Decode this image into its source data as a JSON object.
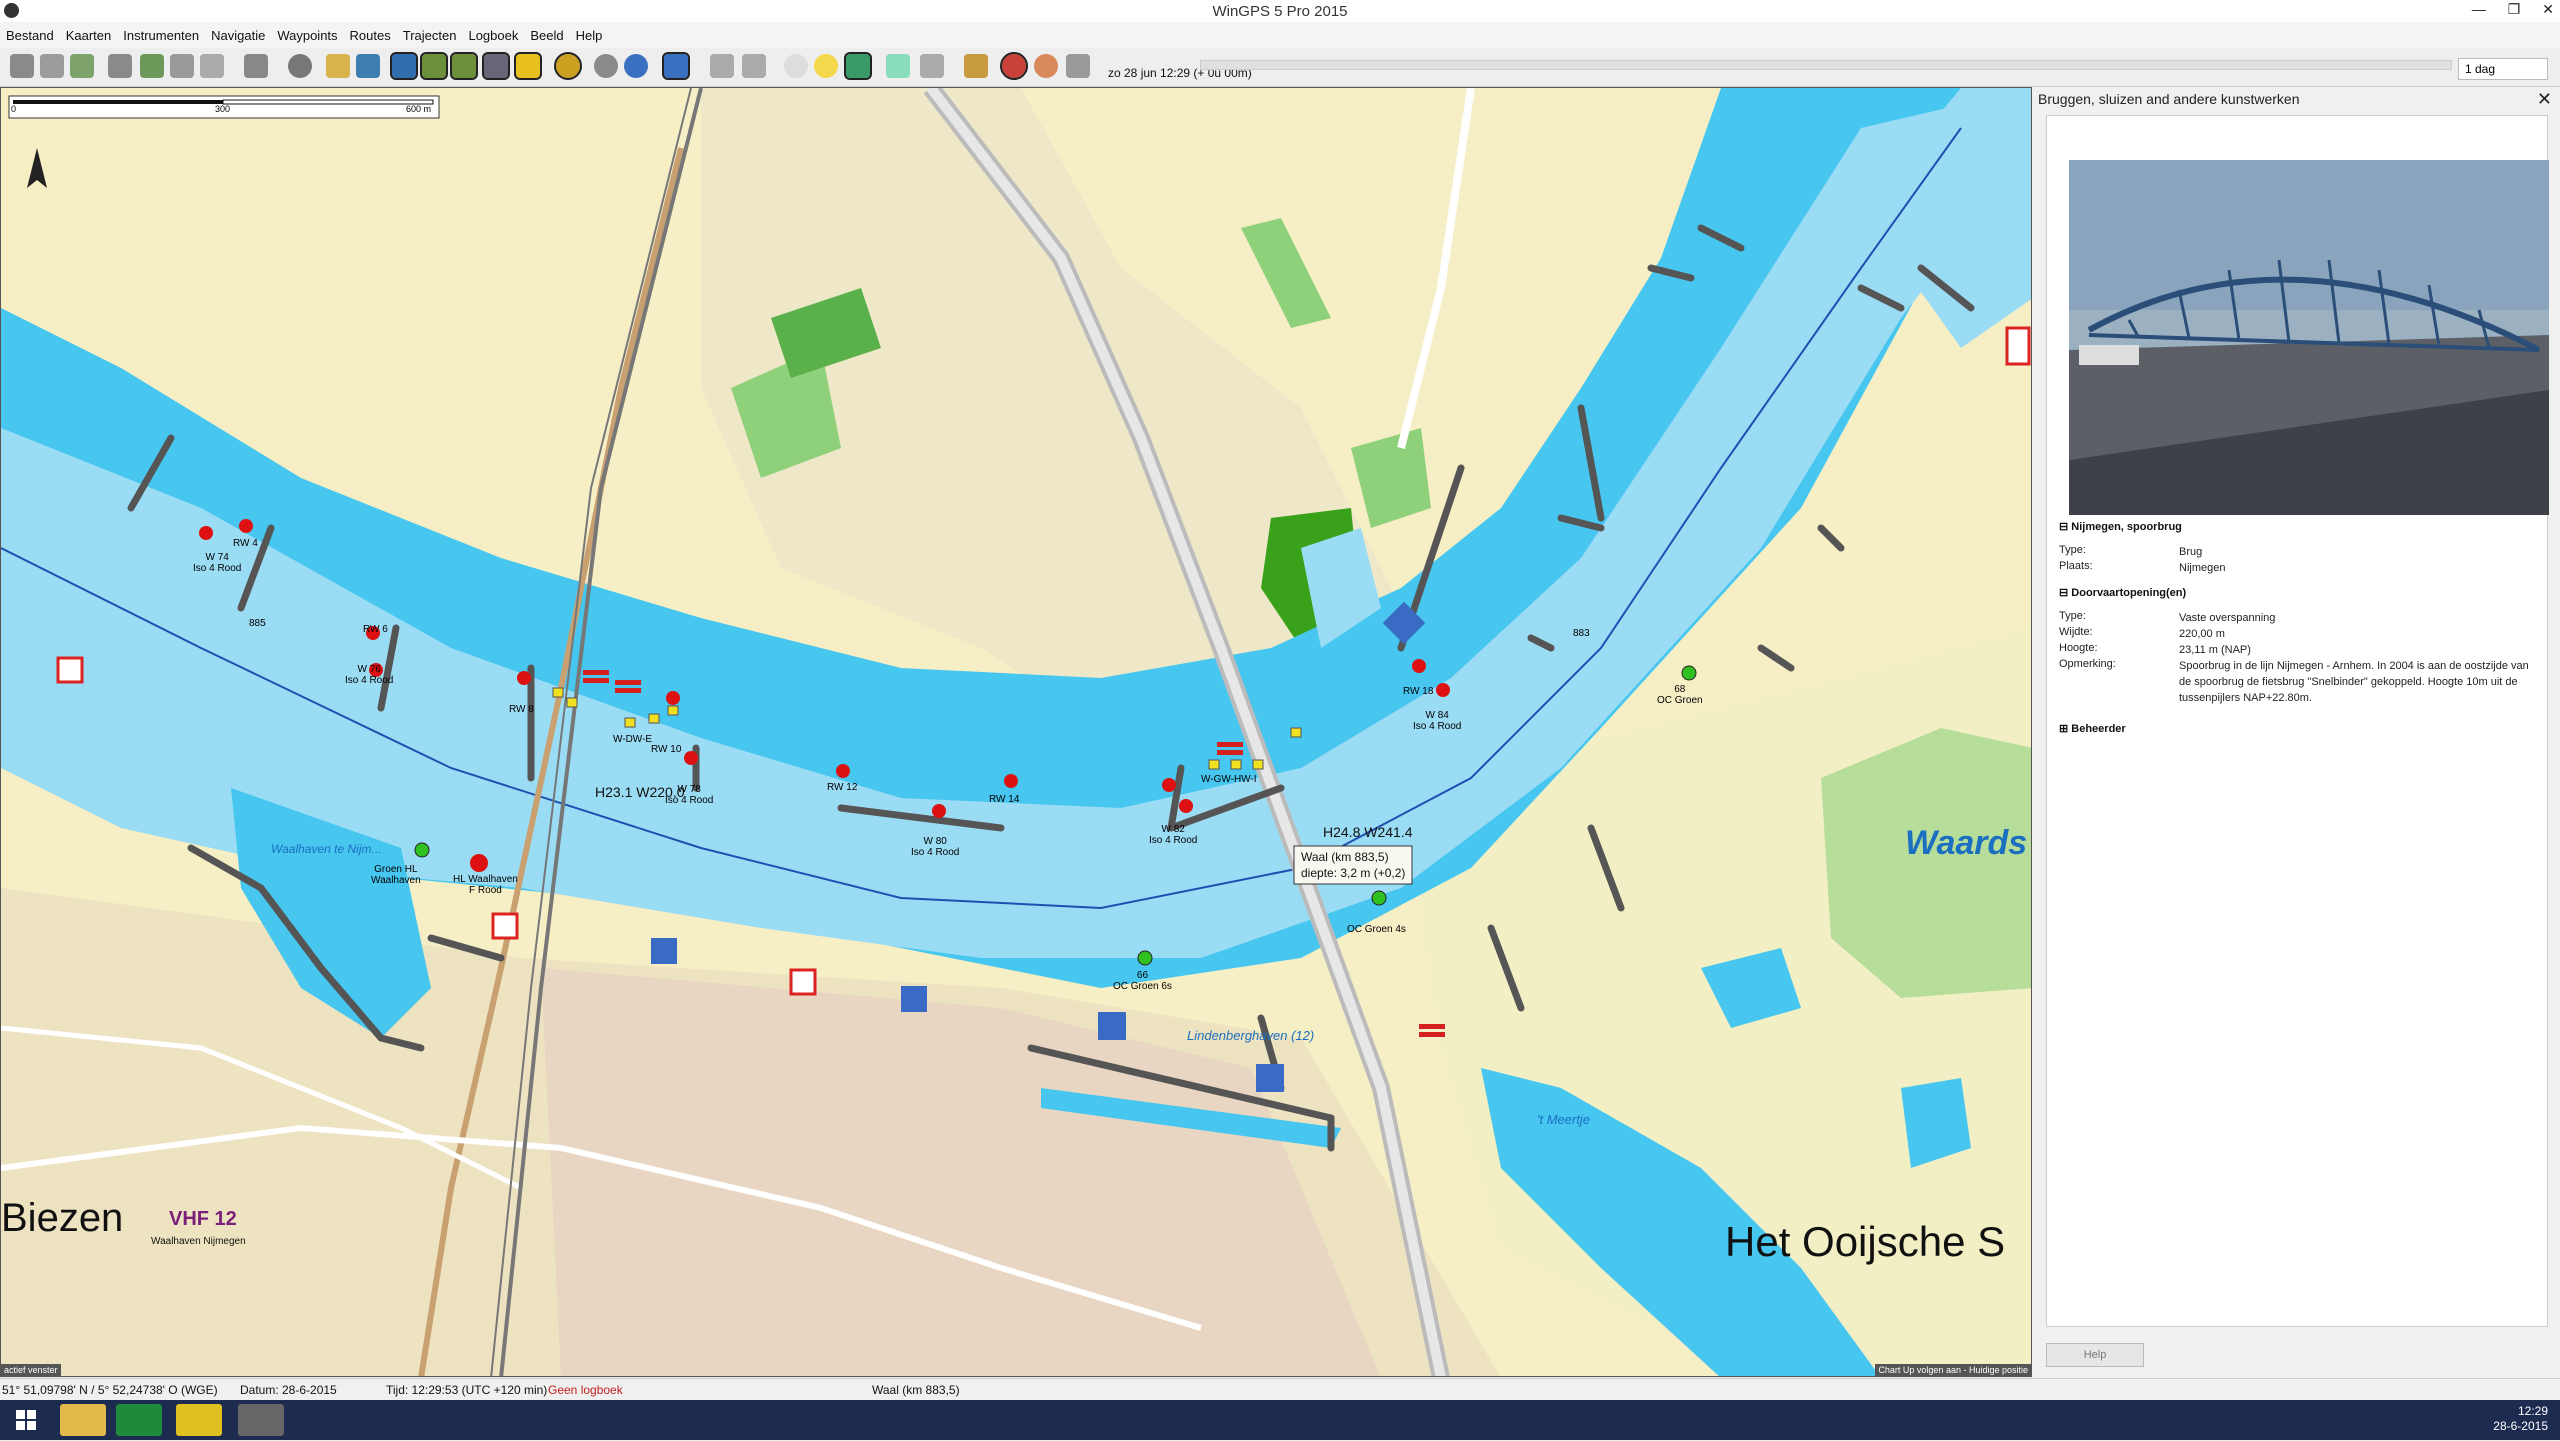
{
  "window": {
    "title": "WinGPS 5 Pro 2015"
  },
  "menu": [
    "Bestand",
    "Kaarten",
    "Instrumenten",
    "Navigatie",
    "Waypoints",
    "Routes",
    "Trajecten",
    "Logboek",
    "Beeld",
    "Help"
  ],
  "toolbar": {
    "time_label": "zo 28 jun 12:29  (+ 0u 00m)",
    "day_select": "1 dag"
  },
  "map": {
    "scale": {
      "ticks": [
        "0",
        "300",
        "600 m"
      ]
    },
    "labels": {
      "biezen": "Biezen",
      "vhf": "VHF 12",
      "waalhaven": "Waalhaven Nijmegen",
      "ooijsche": "Het Ooijsche S",
      "waards": "Waards",
      "meertje": "'t Meertje",
      "lindenberg": "Lindenberghaven (12)",
      "waalhaven_small": "Waalhaven te Nijm..."
    },
    "bridge_labels": [
      "H23.1 W220.0",
      "H24.8 W241.4"
    ],
    "tooltip": {
      "line1": "Waal (km 883,5)",
      "line2": "diepte: 3,2 m (+0,2)"
    },
    "km_marks": [
      "885",
      "883"
    ],
    "buoys": [
      {
        "name": "W 74",
        "sub": "Iso 4 Rood"
      },
      {
        "name": "RW 4",
        "sub": ""
      },
      {
        "name": "RW 6",
        "sub": ""
      },
      {
        "name": "W 76",
        "sub": "Iso 4 Rood"
      },
      {
        "name": "RW 8",
        "sub": ""
      },
      {
        "name": "RW 10",
        "sub": ""
      },
      {
        "name": "W 78",
        "sub": "Iso 4 Rood"
      },
      {
        "name": "RW 12",
        "sub": ""
      },
      {
        "name": "RW 14",
        "sub": ""
      },
      {
        "name": "W 80",
        "sub": "Iso 4 Rood"
      },
      {
        "name": "W 82",
        "sub": "Iso 4 Rood"
      },
      {
        "name": "RW 18",
        "sub": ""
      },
      {
        "name": "W 84",
        "sub": "Iso 4 Rood"
      },
      {
        "name": "66",
        "sub": "OC Groen 6s"
      },
      {
        "name": "OC Groen 4s",
        "sub": ""
      },
      {
        "name": "68",
        "sub": "OC Groen"
      },
      {
        "name": "Groen HL",
        "sub": "Waalhaven"
      },
      {
        "name": "HL Waalhaven",
        "sub": "F Rood"
      },
      {
        "name": "W-DW-E",
        "sub": ""
      },
      {
        "name": "W-GW-HW-I",
        "sub": ""
      }
    ],
    "corner_status": "Chart Up volgen aan - Huidige positie",
    "left_status": "actief venster"
  },
  "sidebar": {
    "title": "Bruggen, sluizen and andere kunstwerken",
    "section1": "Nijmegen, spoorbrug",
    "rows1": [
      {
        "k": "Type:",
        "v": "Brug"
      },
      {
        "k": "Plaats:",
        "v": "Nijmegen"
      }
    ],
    "section2": "Doorvaartopening(en)",
    "rows2": [
      {
        "k": "Type:",
        "v": "Vaste overspanning"
      },
      {
        "k": "Wijdte:",
        "v": "220,00 m"
      },
      {
        "k": "Hoogte:",
        "v": "23,11 m (NAP)"
      },
      {
        "k": "Opmerking:",
        "v": "Spoorbrug in de lijn Nijmegen - Arnhem. In 2004 is aan de oostzijde van de spoorbrug de fietsbrug \"Snelbinder\" gekoppeld. Hoogte 10m uit de tussenpijlers NAP+22.80m."
      }
    ],
    "section3": "Beheerder",
    "help": "Help"
  },
  "status": {
    "coords": "51° 51,09798' N / 5° 52,24738' O (WGE)",
    "datum": "Datum: 28-6-2015",
    "tijd": "Tijd: 12:29:53 (UTC +120 min)",
    "logboek": "Geen logboek",
    "location": "Waal (km 883,5)"
  },
  "clock": {
    "time": "12:29",
    "date": "28-6-2015"
  }
}
